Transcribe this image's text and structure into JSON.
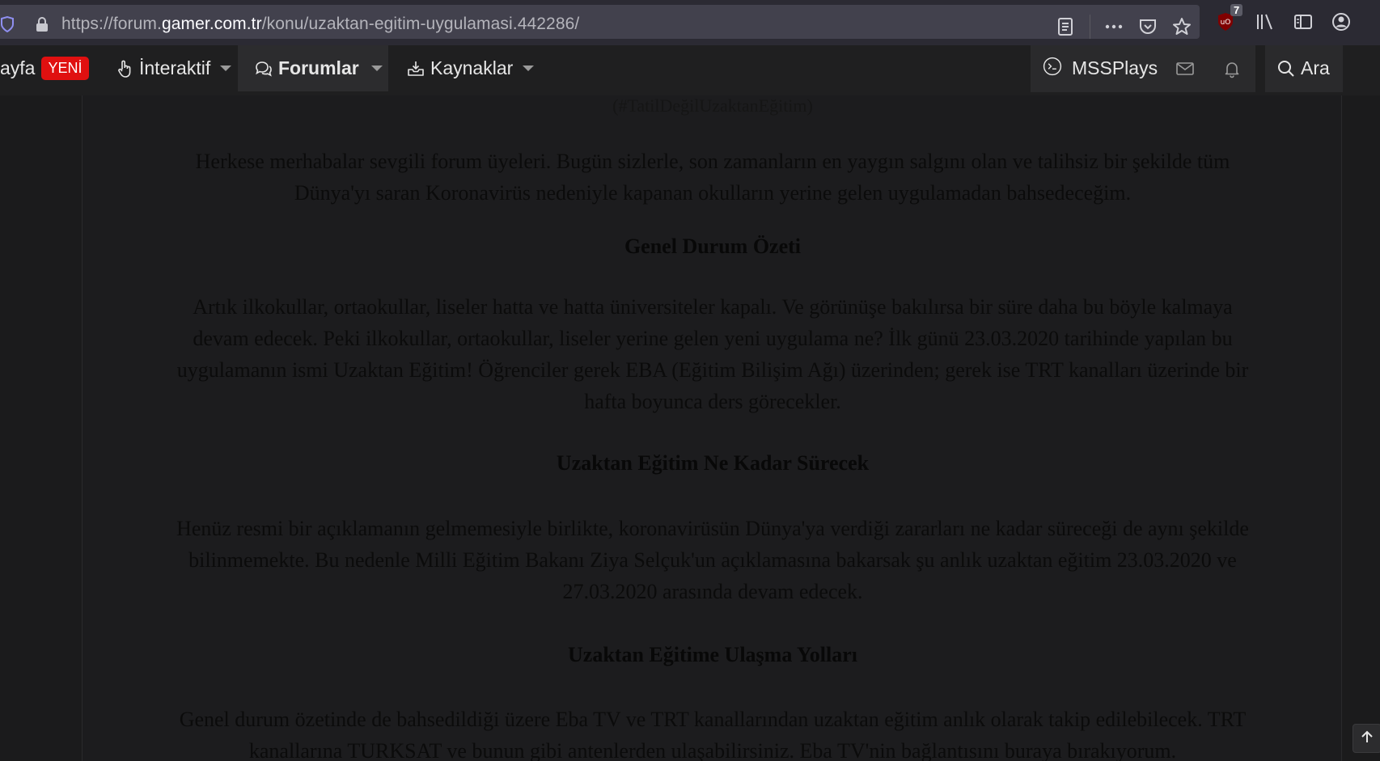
{
  "browser": {
    "url_prefix": "https://forum.",
    "url_domain": "gamer.com.tr",
    "url_path": "/konu/uzaktan-egitim-uygulamasi.442286/",
    "ublock_count": "7"
  },
  "nav": {
    "anasayfa_partial": "ayfa",
    "yeni_badge": "YENİ",
    "interaktif": "İnteraktif",
    "forumlar": "Forumlar",
    "kaynaklar": "Kaynaklar",
    "user": "MSSPlays",
    "search": "Ara"
  },
  "post": {
    "hashtag": "(#TatilDeğilUzaktanEğitim)",
    "intro_lines": [
      "Herkese merhabalar sevgili forum üyeleri. Bugün sizlerle, son zamanların en yaygın salgını olan ve talihsiz bir şekilde tüm",
      "Dünya'yı saran Koronavirüs nedeniyle kapanan okulların yerine gelen uygulamadan bahsedeceğim."
    ],
    "heading1": "Genel Durum Özeti",
    "para1_lines": [
      "Artık ilkokullar, ortaokullar, liseler hatta ve hatta üniversiteler kapalı. Ve görünüşe bakılırsa bir süre daha bu böyle kalmaya",
      "devam edecek. Peki ilkokullar, ortaokullar, liseler yerine gelen yeni uygulama ne? İlk günü 23.03.2020 tarihinde yapılan bu",
      "uygulamanın ismi Uzaktan Eğitim! Öğrenciler gerek EBA (Eğitim Bilişim Ağı) üzerinden; gerek ise TRT kanalları üzerinde bir",
      "hafta boyunca ders görecekler."
    ],
    "heading2": "Uzaktan Eğitim Ne Kadar Sürecek",
    "para2_lines": [
      "Henüz resmi bir açıklamanın gelmemesiyle birlikte, koronavirüsün Dünya'ya verdiği zararları ne kadar süreceği de aynı şekilde",
      "bilinmemekte. Bu nedenle Milli Eğitim Bakanı Ziya Selçuk'un açıklamasına bakarsak şu anlık uzaktan eğitim 23.03.2020 ve",
      "27.03.2020 arasında devam edecek."
    ],
    "heading3": "Uzaktan Eğitime Ulaşma Yolları",
    "para3_lines": [
      "Genel durum özetinde de bahsedildiği üzere Eba TV ve TRT kanallarından uzaktan eğitim anlık olarak takip edilebilecek. TRT",
      "kanallarına TURKSAT ve bunun gibi antenlerden ulaşabilirsiniz. Eba TV'nin bağlantısını buraya bırakıyorum."
    ]
  }
}
